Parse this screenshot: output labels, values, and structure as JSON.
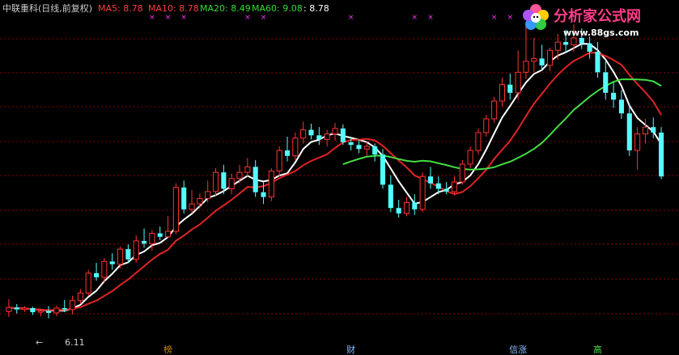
{
  "header": {
    "title": "中联重科(日线,前复权)",
    "ma": [
      {
        "label": "MA5: 8.78",
        "color": "#ff3c3c"
      },
      {
        "label": "MA10: 8.78",
        "color": "#ff3c3c"
      },
      {
        "label": "MA20: 8.49",
        "color": "#33dd33"
      },
      {
        "label": "MA60: 9.08",
        "color": "#33dd33"
      },
      {
        "label": ": 8.78",
        "color": "#ffffff"
      }
    ]
  },
  "watermark": {
    "name": "分析家公式网",
    "url": "www.88gs.com"
  },
  "colors": {
    "up": "#ff3232",
    "down": "#54ffff",
    "grid": "#8a0000",
    "white_line": "#ffffff",
    "red_line": "#e02424",
    "green_line": "#44dd44",
    "marker": "#ff33ff"
  },
  "chart_data": {
    "type": "candlestick",
    "ylim": [
      5.8,
      10.4
    ],
    "grid": "horizontal-dashed",
    "low_annotation": {
      "text": "6.11",
      "value": 6.11,
      "index": 5
    },
    "markers": [
      18,
      20,
      22,
      30,
      32,
      43,
      51,
      53,
      61,
      63
    ],
    "events": [
      {
        "text": "榜",
        "index": 20,
        "color": "#cc8800"
      },
      {
        "text": "财",
        "index": 43,
        "color": "#88bbff"
      },
      {
        "text": "信涨",
        "index": 64,
        "color": "#88bbff"
      },
      {
        "text": "高",
        "index": 74,
        "color": "#44dd44"
      }
    ],
    "candles": [
      [
        6.21,
        6.39,
        6.13,
        6.27
      ],
      [
        6.27,
        6.32,
        6.18,
        6.24
      ],
      [
        6.24,
        6.29,
        6.2,
        6.26
      ],
      [
        6.26,
        6.28,
        6.16,
        6.2
      ],
      [
        6.2,
        6.25,
        6.14,
        6.22
      ],
      [
        6.22,
        6.29,
        6.11,
        6.19
      ],
      [
        6.19,
        6.3,
        6.14,
        6.26
      ],
      [
        6.26,
        6.38,
        6.2,
        6.24
      ],
      [
        6.24,
        6.44,
        6.17,
        6.37
      ],
      [
        6.37,
        6.54,
        6.32,
        6.48
      ],
      [
        6.48,
        6.82,
        6.44,
        6.77
      ],
      [
        6.77,
        6.92,
        6.66,
        6.71
      ],
      [
        6.71,
        6.99,
        6.63,
        6.94
      ],
      [
        6.94,
        7.06,
        6.82,
        6.9
      ],
      [
        6.9,
        7.16,
        6.84,
        7.12
      ],
      [
        7.12,
        7.19,
        6.92,
        6.97
      ],
      [
        6.97,
        7.32,
        6.92,
        7.24
      ],
      [
        7.24,
        7.42,
        7.14,
        7.2
      ],
      [
        7.2,
        7.4,
        7.1,
        7.35
      ],
      [
        7.35,
        7.45,
        7.25,
        7.3
      ],
      [
        7.3,
        7.6,
        7.28,
        7.38
      ],
      [
        7.38,
        8.08,
        7.34,
        8.02
      ],
      [
        8.02,
        8.12,
        7.64,
        7.7
      ],
      [
        7.7,
        7.98,
        7.64,
        7.78
      ],
      [
        7.78,
        7.93,
        7.71,
        7.86
      ],
      [
        7.86,
        8.12,
        7.8,
        7.96
      ],
      [
        7.96,
        8.3,
        7.9,
        8.24
      ],
      [
        8.24,
        8.35,
        7.92,
        8.0
      ],
      [
        8.0,
        8.22,
        7.92,
        8.15
      ],
      [
        8.15,
        8.35,
        8.08,
        8.24
      ],
      [
        8.24,
        8.45,
        8.18,
        8.32
      ],
      [
        8.32,
        8.42,
        7.88,
        7.95
      ],
      [
        7.95,
        8.1,
        7.78,
        7.88
      ],
      [
        7.88,
        8.3,
        7.82,
        8.26
      ],
      [
        8.26,
        8.62,
        8.18,
        8.56
      ],
      [
        8.56,
        8.76,
        8.4,
        8.48
      ],
      [
        8.48,
        8.82,
        8.42,
        8.74
      ],
      [
        8.74,
        8.98,
        8.66,
        8.86
      ],
      [
        8.86,
        8.95,
        8.72,
        8.78
      ],
      [
        8.78,
        8.9,
        8.64,
        8.72
      ],
      [
        8.72,
        8.86,
        8.62,
        8.8
      ],
      [
        8.8,
        8.96,
        8.7,
        8.88
      ],
      [
        8.88,
        8.94,
        8.64,
        8.68
      ],
      [
        8.68,
        8.76,
        8.56,
        8.64
      ],
      [
        8.64,
        8.72,
        8.52,
        8.58
      ],
      [
        8.58,
        8.7,
        8.48,
        8.62
      ],
      [
        8.62,
        8.66,
        8.4,
        8.5
      ],
      [
        8.5,
        8.58,
        8.0,
        8.06
      ],
      [
        8.06,
        8.2,
        7.66,
        7.72
      ],
      [
        7.72,
        7.84,
        7.58,
        7.64
      ],
      [
        7.64,
        7.88,
        7.6,
        7.8
      ],
      [
        7.8,
        7.92,
        7.62,
        7.7
      ],
      [
        7.7,
        8.24,
        7.66,
        8.18
      ],
      [
        8.18,
        8.32,
        8.0,
        8.08
      ],
      [
        8.08,
        8.18,
        7.92,
        8.0
      ],
      [
        8.0,
        8.1,
        7.92,
        7.96
      ],
      [
        7.96,
        8.18,
        7.9,
        8.1
      ],
      [
        8.1,
        8.42,
        8.06,
        8.36
      ],
      [
        8.36,
        8.62,
        8.3,
        8.56
      ],
      [
        8.56,
        8.88,
        8.5,
        8.82
      ],
      [
        8.82,
        9.08,
        8.76,
        9.02
      ],
      [
        9.02,
        9.34,
        8.96,
        9.28
      ],
      [
        9.28,
        9.62,
        9.2,
        9.52
      ],
      [
        9.52,
        9.68,
        9.3,
        9.4
      ],
      [
        9.4,
        10.02,
        9.3,
        9.7
      ],
      [
        9.7,
        10.38,
        9.6,
        9.86
      ],
      [
        9.86,
        10.2,
        9.7,
        9.9
      ],
      [
        9.9,
        10.1,
        9.74,
        9.8
      ],
      [
        9.8,
        10.06,
        9.72,
        10.02
      ],
      [
        10.02,
        10.26,
        9.88,
        10.14
      ],
      [
        10.14,
        10.32,
        9.98,
        10.1
      ],
      [
        10.1,
        10.4,
        10.0,
        10.2
      ],
      [
        10.2,
        10.34,
        10.04,
        10.12
      ],
      [
        10.12,
        10.22,
        9.9,
        10.0
      ],
      [
        10.0,
        10.14,
        9.62,
        9.7
      ],
      [
        9.7,
        9.86,
        9.3,
        9.4
      ],
      [
        9.4,
        9.56,
        9.18,
        9.3
      ],
      [
        9.3,
        9.44,
        9.02,
        9.1
      ],
      [
        9.1,
        9.24,
        8.48,
        8.56
      ],
      [
        8.56,
        8.9,
        8.28,
        8.8
      ],
      [
        8.8,
        9.02,
        8.66,
        8.9
      ],
      [
        8.9,
        9.04,
        8.74,
        8.82
      ],
      [
        8.82,
        8.9,
        8.14,
        8.18
      ]
    ]
  }
}
